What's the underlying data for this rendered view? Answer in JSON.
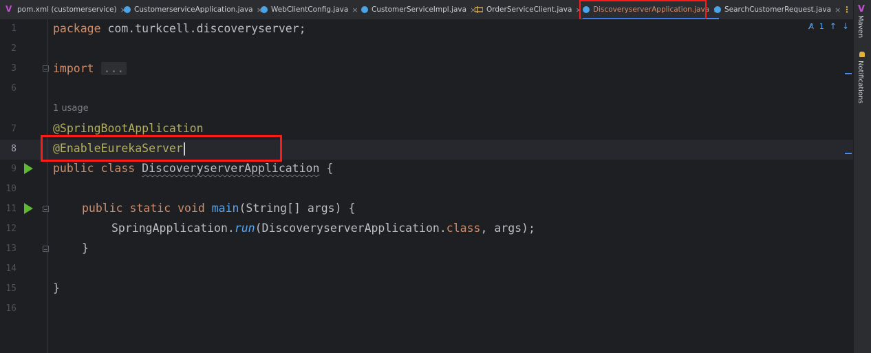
{
  "tabs": [
    {
      "label": "pom.xml (customerservice)",
      "icon": "maven-icon"
    },
    {
      "label": "CustomerserviceApplication.java",
      "icon": "java-class-icon"
    },
    {
      "label": "WebClientConfig.java",
      "icon": "java-class-icon"
    },
    {
      "label": "CustomerServiceImpl.java",
      "icon": "java-class-icon"
    },
    {
      "label": "OrderServiceClient.java",
      "icon": "java-interface-icon"
    },
    {
      "label": "DiscoveryserverApplication.java",
      "icon": "java-class-icon",
      "active": true
    },
    {
      "label": "SearchCustomerRequest.java",
      "icon": "java-class-icon"
    }
  ],
  "close_glyph": "×",
  "more_glyph": "⋮",
  "inspection": {
    "count": "1",
    "up": "↑",
    "down": "↓"
  },
  "line_numbers": [
    "1",
    "2",
    "3",
    "6",
    "7",
    "8",
    "9",
    "10",
    "11",
    "12",
    "13",
    "14",
    "15",
    "16"
  ],
  "code": {
    "package_kw": "package",
    "package_name": " com.turkcell.discoveryserver;",
    "import_kw": "import",
    "import_folded": "...",
    "usage_hint": "1 usage",
    "annotation1": "@SpringBootApplication",
    "annotation2": "@EnableEurekaServer",
    "class_decl_kw": "public class ",
    "class_name": "DiscoveryserverApplication",
    "class_open": " {",
    "main_kw": "public static void ",
    "main_name": "main",
    "main_args": "(String[] args) {",
    "run_target": "SpringApplication.",
    "run_method": "run",
    "run_args_1": "(DiscoveryserverApplication.",
    "run_class_kw": "class",
    "run_args_2": ", args);",
    "close_inner": "}",
    "close_outer": "}"
  },
  "right_strip": {
    "maven_label": "Maven",
    "notifications_label": "Notifications"
  },
  "colors": {
    "highlight": "#ff1a1a",
    "run": "#5fb832",
    "keyword": "#cf8e6d",
    "annotation": "#b3ae60",
    "function": "#56a8f5"
  }
}
